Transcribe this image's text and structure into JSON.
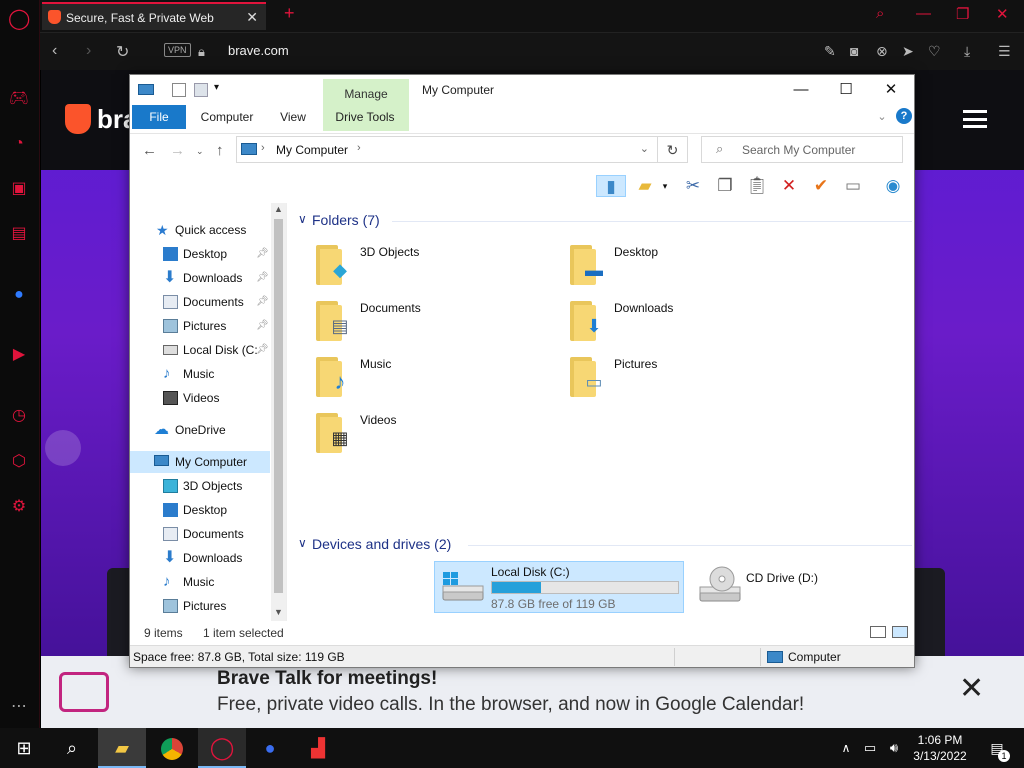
{
  "browser": {
    "tab_title": "Secure, Fast & Private Web",
    "vpn_label": "VPN",
    "url": "brave.com"
  },
  "page": {
    "brand_partial": "bra",
    "banner_title": "Brave Talk for meetings!",
    "banner_subtitle": "Free, private video calls. In the browser, and now in Google Calendar!"
  },
  "explorer": {
    "window_title": "My Computer",
    "manage_label": "Manage",
    "tabs": [
      "File",
      "Computer",
      "View",
      "Drive Tools"
    ],
    "address": "My Computer",
    "search_placeholder": "Search My Computer",
    "nav_pane": [
      {
        "label": "Quick access"
      },
      {
        "label": "Desktop"
      },
      {
        "label": "Downloads"
      },
      {
        "label": "Documents"
      },
      {
        "label": "Pictures"
      },
      {
        "label": "Local Disk (C:"
      },
      {
        "label": "Music"
      },
      {
        "label": "Videos"
      },
      {
        "label": "OneDrive"
      },
      {
        "label": "My Computer"
      },
      {
        "label": "3D Objects"
      },
      {
        "label": "Desktop"
      },
      {
        "label": "Documents"
      },
      {
        "label": "Downloads"
      },
      {
        "label": "Music"
      },
      {
        "label": "Pictures"
      }
    ],
    "groups": {
      "folders": "Folders (7)",
      "devices": "Devices and drives (2)"
    },
    "folders": [
      "3D Objects",
      "Desktop",
      "Documents",
      "Downloads",
      "Music",
      "Pictures",
      "Videos"
    ],
    "drives": {
      "c_name": "Local Disk (C:)",
      "c_free": "87.8 GB free of 119 GB",
      "c_used_fraction": 0.262,
      "d_name": "CD Drive (D:)"
    },
    "status": {
      "items": "9 items",
      "selected": "1 item selected",
      "space": "Space free: 87.8 GB, Total size: 119 GB",
      "location": "Computer"
    }
  },
  "taskbar": {
    "time": "1:06 PM",
    "date": "3/13/2022",
    "notification_count": "1"
  },
  "colors": {
    "accent_opera": "#e0143c",
    "explorer_blue": "#1979ca",
    "selection": "#cce8ff"
  }
}
